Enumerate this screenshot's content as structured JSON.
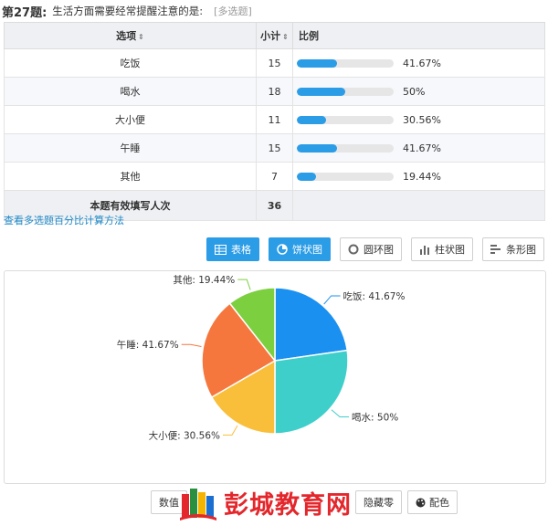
{
  "question": {
    "number": "第27题:",
    "text": "生活方面需要经常提醒注意的是:",
    "type": "[多选题]"
  },
  "table": {
    "headers": {
      "option": "选项",
      "count": "小计",
      "ratio": "比例"
    },
    "rows": [
      {
        "option": "吃饭",
        "count": "15",
        "pct_label": "41.67%",
        "pct": 41.67
      },
      {
        "option": "喝水",
        "count": "18",
        "pct_label": "50%",
        "pct": 50
      },
      {
        "option": "大小便",
        "count": "11",
        "pct_label": "30.56%",
        "pct": 30.56
      },
      {
        "option": "午睡",
        "count": "15",
        "pct_label": "41.67%",
        "pct": 41.67
      },
      {
        "option": "其他",
        "count": "7",
        "pct_label": "19.44%",
        "pct": 19.44
      }
    ],
    "total": {
      "label": "本题有效填写人次",
      "count": "36"
    }
  },
  "calc_link": "查看多选题百分比计算方法",
  "view_buttons": {
    "table": "表格",
    "pie": "饼状图",
    "ring": "圆环图",
    "column": "柱状图",
    "bar": "条形图",
    "active": "pie"
  },
  "chart_data": {
    "type": "pie",
    "slices": [
      {
        "label": "吃饭: 41.67%",
        "name": "吃饭",
        "value": 15,
        "color": "#1a90f0"
      },
      {
        "label": "喝水: 50%",
        "name": "喝水",
        "value": 18,
        "color": "#3ecfcb"
      },
      {
        "label": "大小便: 30.56%",
        "name": "大小便",
        "value": 11,
        "color": "#f9bf3b"
      },
      {
        "label": "午睡: 41.67%",
        "name": "午睡",
        "value": 15,
        "color": "#f5773e"
      },
      {
        "label": "其他: 19.44%",
        "name": "其他",
        "value": 7,
        "color": "#7ccf3f"
      }
    ]
  },
  "bottom_buttons": {
    "values": "数值",
    "hide": "隐藏零",
    "color": "配色"
  },
  "watermark": {
    "text": "彭城教育网"
  },
  "colors": {
    "accent": "#2b9ce6",
    "link": "#1e88c7",
    "watermark": "#e3272c"
  }
}
